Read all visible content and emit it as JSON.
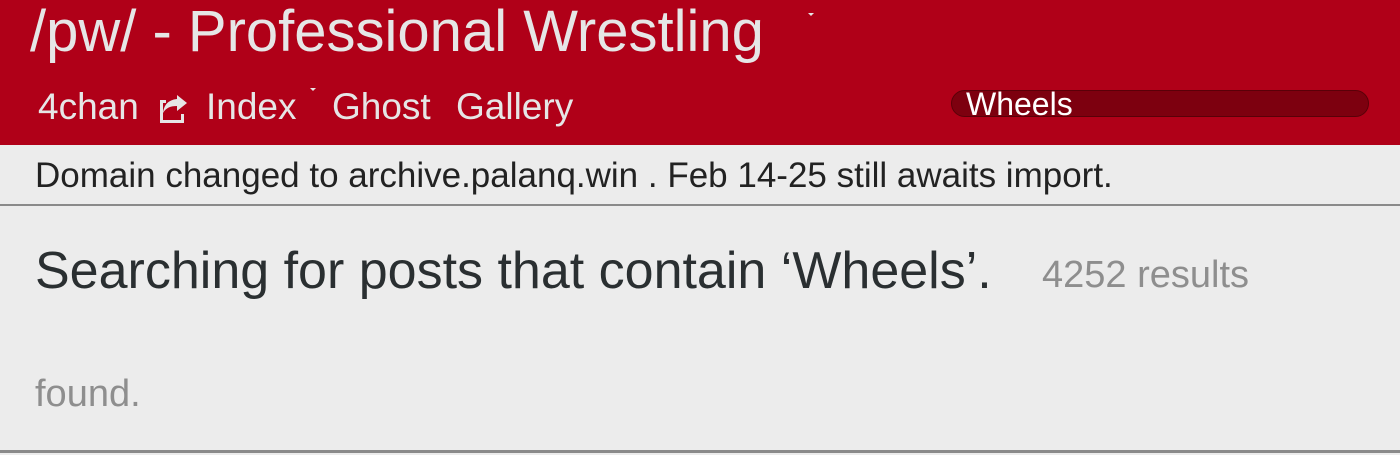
{
  "header": {
    "board_title": "/pw/ - Professional Wrestling",
    "nav": {
      "fourchan": "4chan",
      "index": "Index",
      "ghost": "Ghost",
      "gallery": "Gallery"
    },
    "search_value": "Wheels",
    "colors": {
      "header_bg": "#b00018",
      "search_bg": "#7d000f"
    }
  },
  "notice": {
    "text": "Domain changed to archive.palanq.win . Feb 14-25 still awaits import."
  },
  "search": {
    "heading": "Searching for posts that contain ‘Wheels’.",
    "count_text": "4252 results",
    "found_text": "found."
  },
  "icons": {
    "external": "share-external-icon"
  }
}
